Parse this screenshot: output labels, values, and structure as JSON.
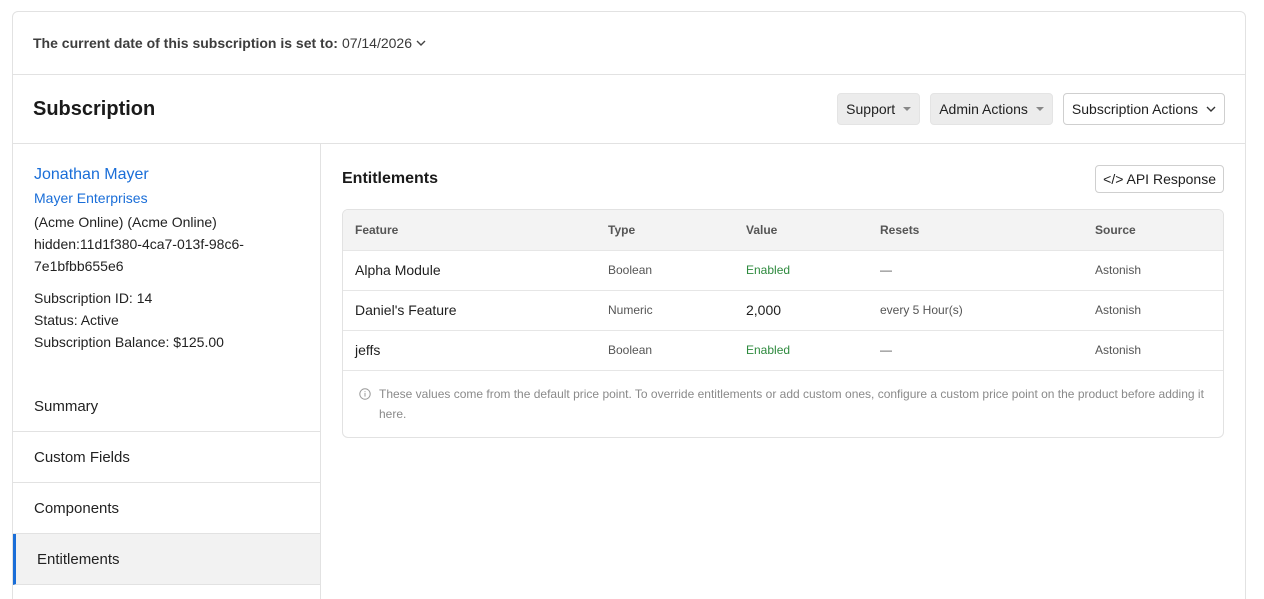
{
  "date_bar": {
    "label": "The current date of this subscription is set to:",
    "value": "07/14/2026"
  },
  "header": {
    "title": "Subscription",
    "support_label": "Support",
    "admin_label": "Admin Actions",
    "subscription_actions_label": "Subscription Actions"
  },
  "customer": {
    "name": "Jonathan Mayer",
    "organization": "Mayer Enterprises",
    "product": "(Acme Online) (Acme Online)",
    "reference_1": "hidden:11d1f380-4ca7-013f-98c6-",
    "reference_2": "7e1bfbb655e6",
    "subscription_id": "Subscription ID: 14",
    "status": "Status: Active",
    "balance": "Subscription Balance: $125.00"
  },
  "nav": {
    "items": [
      {
        "label": "Summary"
      },
      {
        "label": "Custom Fields"
      },
      {
        "label": "Components"
      },
      {
        "label": "Entitlements"
      }
    ],
    "active": "Entitlements"
  },
  "entitlements": {
    "title": "Entitlements",
    "api_button": "</> API Response",
    "columns": [
      "Feature",
      "Type",
      "Value",
      "Resets",
      "Source"
    ],
    "rows": [
      {
        "feature": "Alpha Module",
        "type": "Boolean",
        "value": "Enabled",
        "resets": "—",
        "source": "Astonish"
      },
      {
        "feature": "Daniel's Feature",
        "type": "Numeric",
        "value": "2,000",
        "resets": "every 5 Hour(s)",
        "source": "Astonish"
      },
      {
        "feature": "jeffs",
        "type": "Boolean",
        "value": "Enabled",
        "resets": "—",
        "source": "Astonish"
      }
    ],
    "note": "These values come from the default price point. To override entitlements or add custom ones, configure a custom price point on the product before adding it here."
  },
  "colors": {
    "link": "#1a6ed8",
    "enabled": "#2e8a3e",
    "border": "#e2e2e2"
  },
  "icons": {
    "date_dropdown": "chevron-down-icon",
    "info": "info-icon"
  }
}
